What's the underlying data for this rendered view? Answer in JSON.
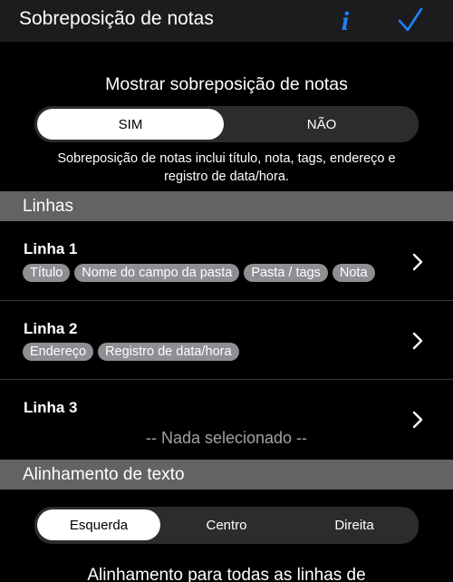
{
  "nav": {
    "title": "Sobreposição de notas",
    "info_glyph": "i",
    "accent_color": "#1a82ff"
  },
  "overlay": {
    "label": "Mostrar sobreposição de notas",
    "options": [
      "SIM",
      "NÃO"
    ],
    "selected": "SIM",
    "description": "Sobreposição de notas inclui título, nota, tags, endereço e registro de data/hora."
  },
  "lines_section": {
    "header": "Linhas",
    "rows": [
      {
        "title": "Linha 1",
        "tags": [
          "Título",
          "Nome do campo da pasta",
          "Pasta / tags",
          "Nota"
        ]
      },
      {
        "title": "Linha 2",
        "tags": [
          "Endereço",
          "Registro de data/hora"
        ]
      },
      {
        "title": "Linha 3",
        "empty_text": "-- Nada selecionado --"
      }
    ]
  },
  "alignment_section": {
    "header": "Alinhamento de texto",
    "options": [
      "Esquerda",
      "Centro",
      "Direita"
    ],
    "selected": "Esquerda",
    "description": "Alinhamento para todas as linhas de"
  },
  "icons": {
    "info": "info-icon",
    "done": "checkmark-icon",
    "row_disclosure": "chevron-right-icon"
  }
}
